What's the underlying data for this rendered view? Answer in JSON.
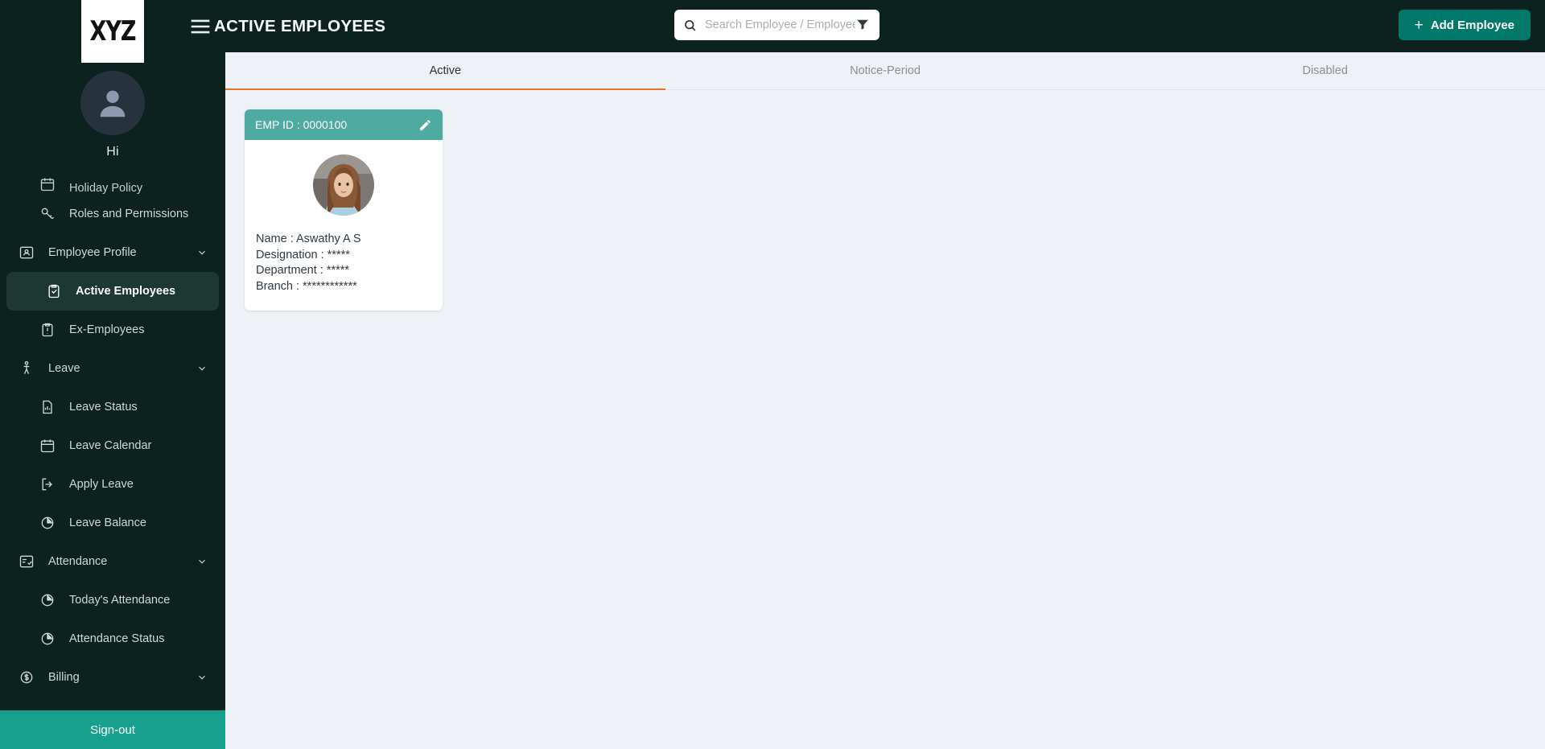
{
  "brand": {
    "logo_text": "XYZ",
    "greeting": "Hi"
  },
  "colors": {
    "sidebar_bg": "#0b221e",
    "signout_bg": "#16a08d",
    "accent_teal": "#4faaa2",
    "add_button": "#00796b",
    "active_tab_underline": "#e8762c",
    "content_bg": "#eef1f6"
  },
  "sidebar": {
    "hamburger_icon": "hamburger-icon",
    "avatar_icon": "user-avatar-icon",
    "items": [
      {
        "label": "Holiday Policy",
        "icon": "calendar-icon",
        "level": "child",
        "clipped": true,
        "active": false,
        "chevron": false
      },
      {
        "label": "Roles and Permissions",
        "icon": "key-icon",
        "level": "child",
        "clipped": false,
        "active": false,
        "chevron": false
      },
      {
        "label": "Employee Profile",
        "icon": "id-card-icon",
        "level": "parent",
        "clipped": false,
        "active": false,
        "chevron": true
      },
      {
        "label": "Active Employees",
        "icon": "clipboard-check-icon",
        "level": "child",
        "clipped": false,
        "active": true,
        "chevron": false
      },
      {
        "label": "Ex-Employees",
        "icon": "clipboard-alert-icon",
        "level": "child",
        "clipped": false,
        "active": false,
        "chevron": false
      },
      {
        "label": "Leave",
        "icon": "walking-person-icon",
        "level": "parent",
        "clipped": false,
        "active": false,
        "chevron": true
      },
      {
        "label": "Leave Status",
        "icon": "document-chart-icon",
        "level": "child",
        "clipped": false,
        "active": false,
        "chevron": false
      },
      {
        "label": "Leave Calendar",
        "icon": "calendar-icon",
        "level": "child",
        "clipped": false,
        "active": false,
        "chevron": false
      },
      {
        "label": "Apply Leave",
        "icon": "logout-arrow-icon",
        "level": "child",
        "clipped": false,
        "active": false,
        "chevron": false
      },
      {
        "label": "Leave Balance",
        "icon": "pie-chart-icon",
        "level": "child",
        "clipped": false,
        "active": false,
        "chevron": false
      },
      {
        "label": "Attendance",
        "icon": "list-check-icon",
        "level": "parent",
        "clipped": false,
        "active": false,
        "chevron": true
      },
      {
        "label": "Today's Attendance",
        "icon": "pie-chart-icon",
        "level": "child",
        "clipped": false,
        "active": false,
        "chevron": false
      },
      {
        "label": "Attendance Status",
        "icon": "pie-chart-icon",
        "level": "child",
        "clipped": false,
        "active": false,
        "chevron": false
      },
      {
        "label": "Billing",
        "icon": "dollar-circle-icon",
        "level": "parent",
        "clipped": false,
        "active": false,
        "chevron": true
      }
    ],
    "signout_label": "Sign-out"
  },
  "header": {
    "title": "ACTIVE EMPLOYEES",
    "hamburger_icon": "hamburger-icon",
    "search": {
      "placeholder": "Search Employee / Employee I",
      "value": "",
      "search_icon": "search-icon",
      "filter_icon": "filter-funnel-icon"
    },
    "add_button": {
      "label": "Add Employee",
      "plus_icon": "plus-icon"
    }
  },
  "tabs": [
    {
      "label": "Active",
      "active": true
    },
    {
      "label": "Notice-Period",
      "active": false
    },
    {
      "label": "Disabled",
      "active": false
    }
  ],
  "employee_cards": [
    {
      "emp_id_label": "EMP ID : 0000100",
      "edit_icon": "pencil-edit-icon",
      "photo_icon": "employee-photo",
      "lines": [
        "Name : Aswathy A S",
        "Designation : *****",
        "Department : *****",
        "Branch : ************"
      ]
    }
  ]
}
